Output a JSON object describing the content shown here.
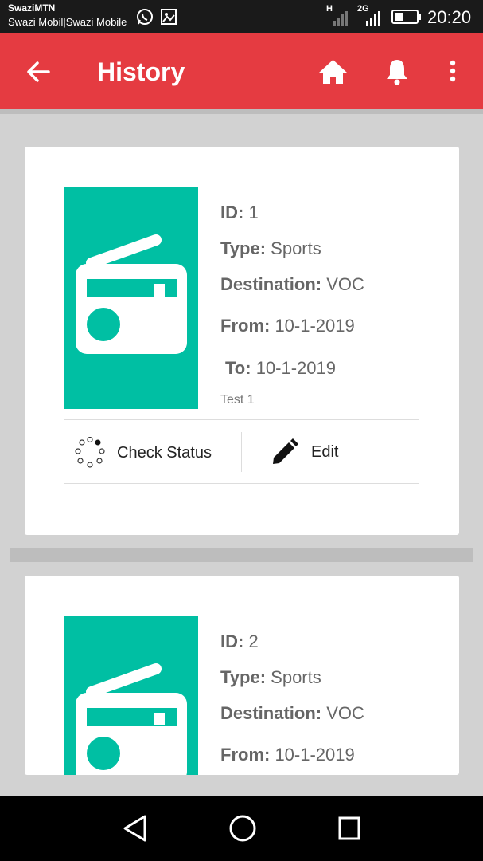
{
  "status_bar": {
    "carrier_line1": "SwaziMTN",
    "carrier_line2": "Swazi Mobil|Swazi Mobile",
    "network_h": "H",
    "network_2g": "2G",
    "time": "20:20"
  },
  "app_bar": {
    "title": "History",
    "back_icon": "arrow-left-icon",
    "home_icon": "home-icon",
    "bell_icon": "bell-icon",
    "menu_icon": "more-vert-icon"
  },
  "cards": [
    {
      "id_label": "ID:",
      "id_value": " 1",
      "type_label": "Type:",
      "type_value": " Sports",
      "dest_label": "Destination:",
      "dest_value": " VOC",
      "from_label": "From:",
      "from_value": " 10-1-2019",
      "to_label": "To:",
      "to_value": " 10-1-2019",
      "note": "Test 1",
      "check_status_label": "Check Status",
      "edit_label": "Edit"
    },
    {
      "id_label": "ID:",
      "id_value": " 2",
      "type_label": "Type:",
      "type_value": " Sports",
      "dest_label": "Destination:",
      "dest_value": " VOC",
      "from_label": "From:",
      "from_value": " 10-1-2019"
    }
  ],
  "colors": {
    "app_bar": "#e53b41",
    "thumb": "#00bfa3",
    "background": "#d2d2d2"
  },
  "nav_bar": {
    "back_icon": "nav-back-icon",
    "home_icon": "nav-home-icon",
    "recents_icon": "nav-recents-icon"
  }
}
